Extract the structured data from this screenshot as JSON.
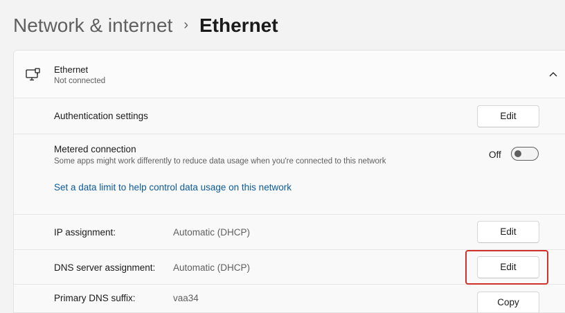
{
  "breadcrumb": {
    "parent": "Network & internet",
    "separator": "›",
    "current": "Ethernet"
  },
  "adapter": {
    "icon": "ethernet-icon",
    "name": "Ethernet",
    "status": "Not connected",
    "expand_icon": "chevron-up-icon"
  },
  "auth": {
    "label": "Authentication settings",
    "button": "Edit"
  },
  "metered": {
    "label": "Metered connection",
    "description": "Some apps might work differently to reduce data usage when you're connected to this network",
    "toggle_state": "Off",
    "link": "Set a data limit to help control data usage on this network"
  },
  "ip": {
    "label": "IP assignment:",
    "value": "Automatic (DHCP)",
    "button": "Edit"
  },
  "dns": {
    "label": "DNS server assignment:",
    "value": "Automatic (DHCP)",
    "button": "Edit"
  },
  "dns_suffix": {
    "label": "Primary DNS suffix:",
    "value": "vaa34",
    "button": "Copy"
  },
  "colors": {
    "accent_link": "#0b5a9d",
    "highlight": "#d2302a"
  }
}
